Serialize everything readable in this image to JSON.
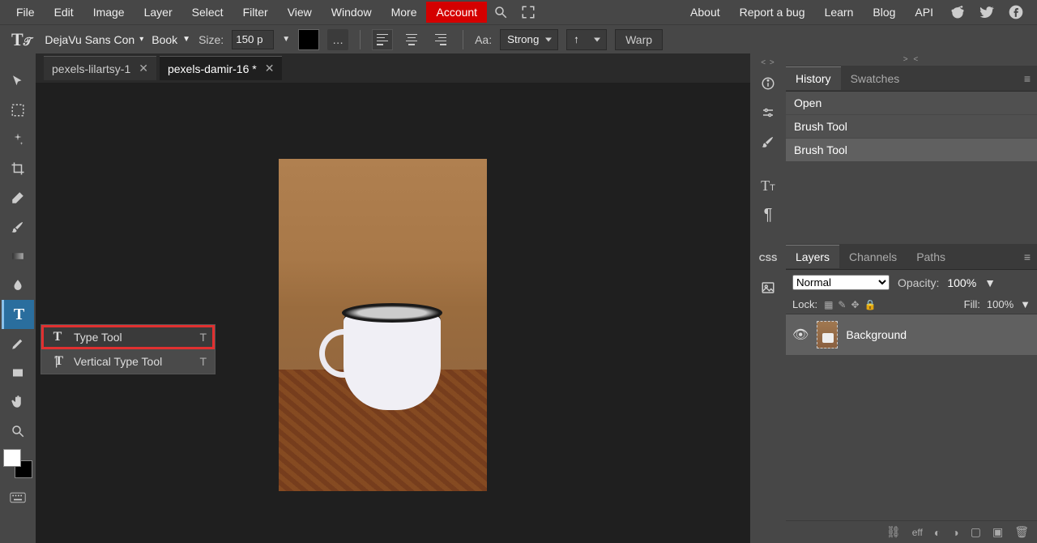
{
  "menu": {
    "items": [
      "File",
      "Edit",
      "Image",
      "Layer",
      "Select",
      "Filter",
      "View",
      "Window",
      "More",
      "Account"
    ],
    "right": [
      "About",
      "Report a bug",
      "Learn",
      "Blog",
      "API"
    ]
  },
  "options": {
    "font": "DejaVu Sans Con",
    "weight": "Book",
    "size_label": "Size:",
    "size": "150 p",
    "aa_label": "Aa:",
    "aa_mode": "Strong",
    "warp": "Warp"
  },
  "tabs": [
    {
      "name": "pexels-lilartsy-1",
      "active": false
    },
    {
      "name": "pexels-damir-16 *",
      "active": true
    }
  ],
  "ctx": {
    "items": [
      {
        "label": "Type Tool",
        "shortcut": "T",
        "highlighted": true,
        "icon": "T"
      },
      {
        "label": "Vertical Type Tool",
        "shortcut": "T",
        "highlighted": false,
        "icon": "|T"
      }
    ]
  },
  "history": {
    "tabs": [
      "History",
      "Swatches"
    ],
    "items": [
      "Open",
      "Brush Tool",
      "Brush Tool"
    ]
  },
  "layers": {
    "tabs": [
      "Layers",
      "Channels",
      "Paths"
    ],
    "blend": "Normal",
    "opacity_label": "Opacity:",
    "opacity": "100%",
    "lock_label": "Lock:",
    "fill_label": "Fill:",
    "fill": "100%",
    "entries": [
      {
        "name": "Background"
      }
    ]
  },
  "footer_icons": [
    "link-icon",
    "effects-label",
    "mask-icon",
    "adjust-icon",
    "group-icon",
    "new-layer-icon",
    "trash-icon"
  ],
  "footer_eff": "eff"
}
